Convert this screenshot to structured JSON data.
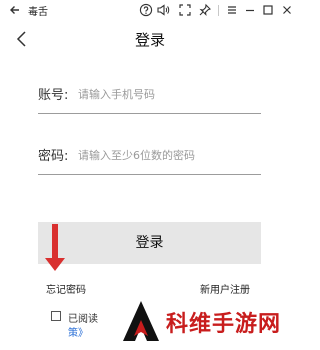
{
  "window": {
    "title": "毒舌",
    "icons": [
      "back-arrow-icon",
      "help-circle-icon",
      "speaker-icon",
      "fullscreen-icon",
      "pin-icon",
      "menu-icon",
      "minimize-icon",
      "maximize-icon",
      "close-icon"
    ]
  },
  "page": {
    "title": "登录"
  },
  "form": {
    "account_label": "账号:",
    "account_placeholder": "请输入手机号码",
    "account_value": "",
    "password_label": "密码:",
    "password_placeholder": "请输入至少6位数的密码",
    "password_value": ""
  },
  "actions": {
    "login_label": "登录",
    "forgot_password": "忘记密码",
    "register": "新用户注册"
  },
  "agreement": {
    "checked": false,
    "read_text": "已阅读",
    "policy_text": "策》"
  },
  "watermark": {
    "text": "科维手游网"
  },
  "colors": {
    "annotation_arrow": "#d9302f",
    "watermark_text": "#c81d1d",
    "link_blue": "#2a6fd6",
    "button_bg": "#e6e6e6"
  }
}
